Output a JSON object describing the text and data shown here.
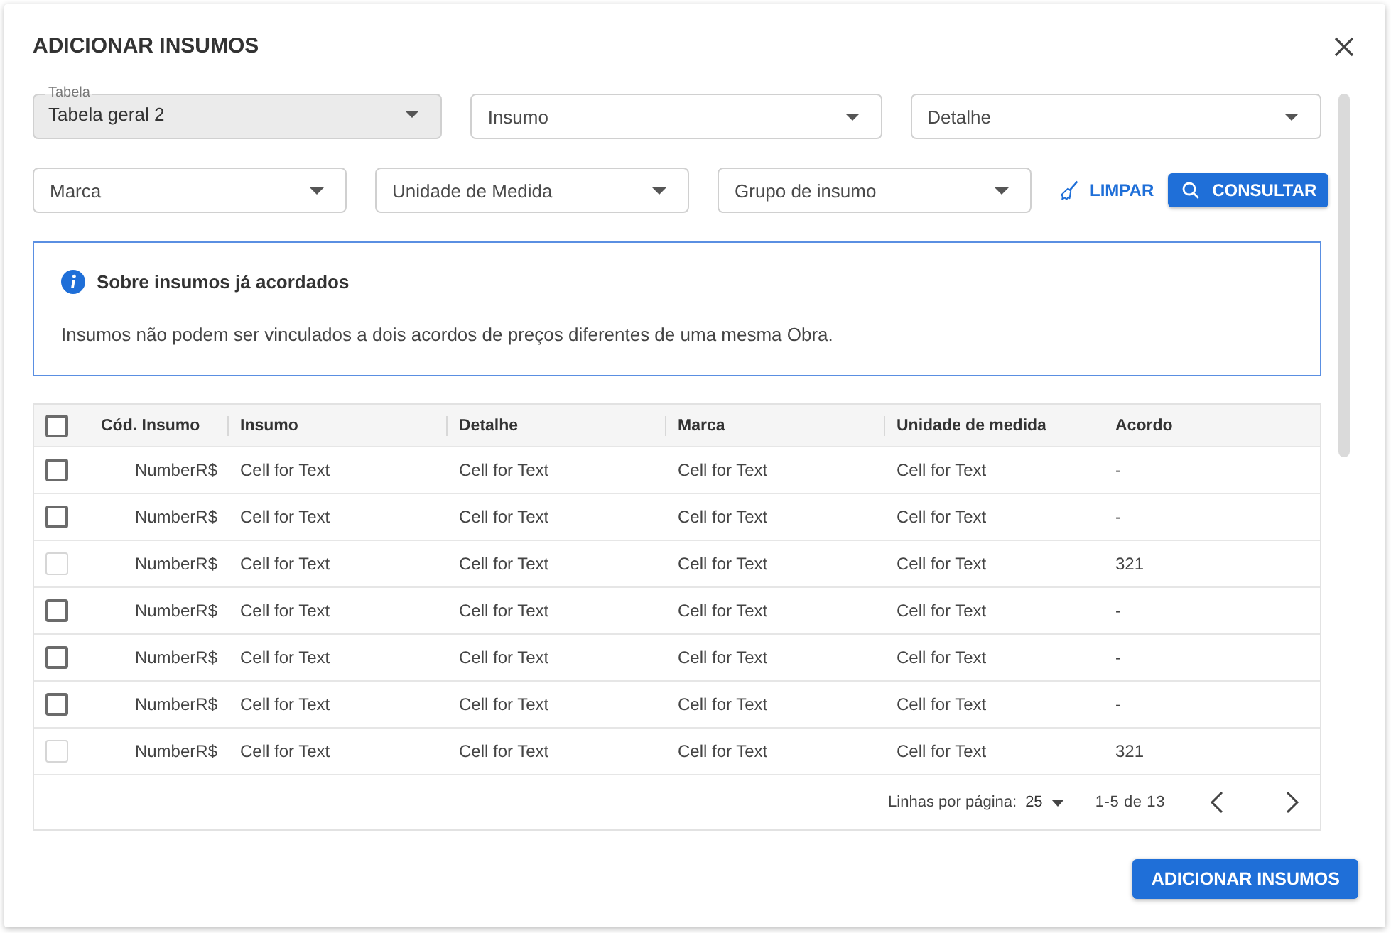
{
  "dialog": {
    "title": "ADICIONAR INSUMOS"
  },
  "filter_rows": [
    [
      {
        "label": "Tabela",
        "value": "Tabela geral 2",
        "disabled": true
      },
      {
        "placeholder": "Insumo",
        "disabled": false
      },
      {
        "placeholder": "Detalhe",
        "disabled": false
      }
    ],
    [
      {
        "placeholder": "Marca",
        "disabled": false
      },
      {
        "placeholder": "Unidade de Medida",
        "disabled": false
      },
      {
        "placeholder": "Grupo de insumo",
        "disabled": false
      }
    ]
  ],
  "clear_button": {
    "label": "LIMPAR"
  },
  "search_button": {
    "label": "CONSULTAR"
  },
  "notice": {
    "title": "Sobre insumos já acordados",
    "text": "Insumos não podem ser vinculados a dois acordos de preços diferentes de uma mesma Obra."
  },
  "table": {
    "select_all": {
      "checked": false
    },
    "columns": [
      "Cód. Insumo",
      "Insumo",
      "Detalhe",
      "Marca",
      "Unidade de medida",
      "Acordo"
    ],
    "rows": [
      {
        "checked": false,
        "disabled": false,
        "cells": [
          "NumberR$",
          "Cell for Text",
          "Cell for Text",
          "Cell for Text",
          "Cell for Text",
          "-"
        ]
      },
      {
        "checked": false,
        "disabled": false,
        "cells": [
          "NumberR$",
          "Cell for Text",
          "Cell for Text",
          "Cell for Text",
          "Cell for Text",
          "-"
        ]
      },
      {
        "checked": false,
        "disabled": true,
        "cells": [
          "NumberR$",
          "Cell for Text",
          "Cell for Text",
          "Cell for Text",
          "Cell for Text",
          "321"
        ]
      },
      {
        "checked": false,
        "disabled": false,
        "cells": [
          "NumberR$",
          "Cell for Text",
          "Cell for Text",
          "Cell for Text",
          "Cell for Text",
          "-"
        ]
      },
      {
        "checked": false,
        "disabled": false,
        "cells": [
          "NumberR$",
          "Cell for Text",
          "Cell for Text",
          "Cell for Text",
          "Cell for Text",
          "-"
        ]
      },
      {
        "checked": false,
        "disabled": false,
        "cells": [
          "NumberR$",
          "Cell for Text",
          "Cell for Text",
          "Cell for Text",
          "Cell for Text",
          "-"
        ]
      },
      {
        "checked": false,
        "disabled": true,
        "cells": [
          "NumberR$",
          "Cell for Text",
          "Cell for Text",
          "Cell for Text",
          "Cell for Text",
          "321"
        ]
      }
    ],
    "pagination": {
      "rows_per_page_label": "Linhas por página:",
      "rows_per_page": "25",
      "range": "1-5 de 13"
    }
  },
  "submit_button": {
    "label": "ADICIONAR INSUMOS"
  }
}
